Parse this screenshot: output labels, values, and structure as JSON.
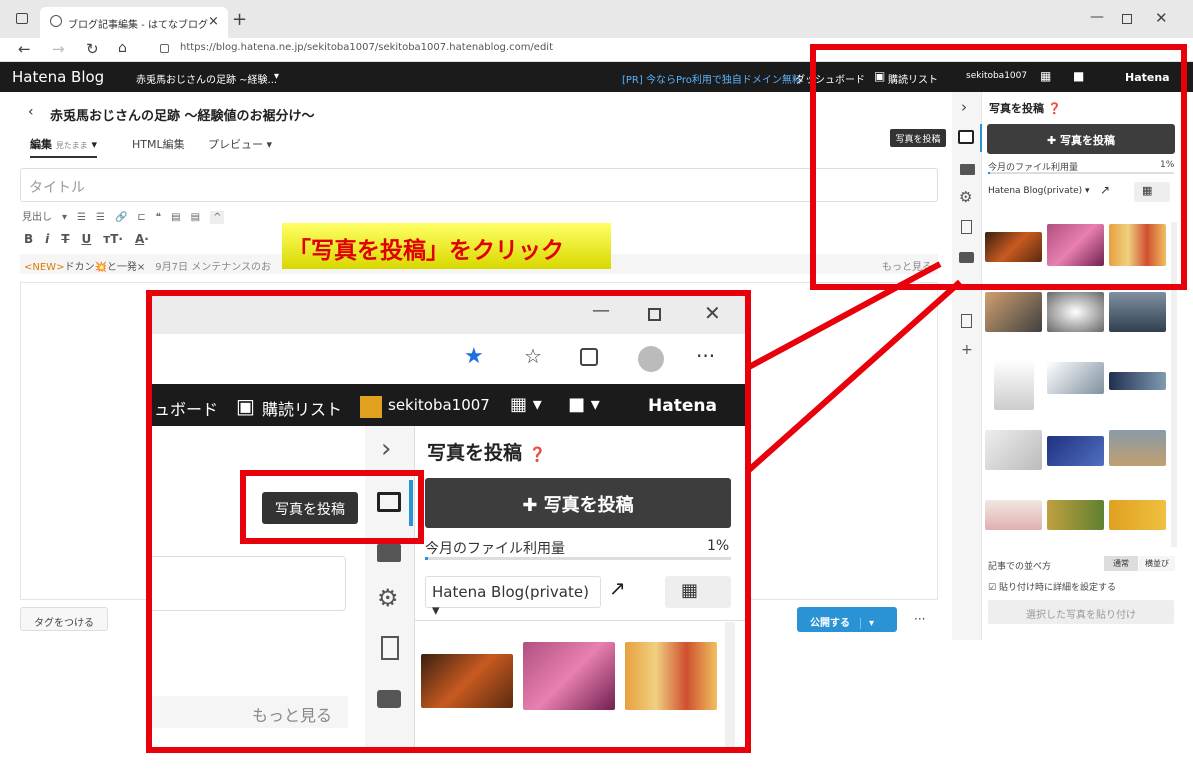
{
  "browser": {
    "tab_title": "ブログ記事編集 - はてなブログ",
    "url": "https://blog.hatena.ne.jp/sekitoba1007/sekitoba1007.hatenablog.com/edit"
  },
  "hatena_bar": {
    "logo": "Hatena Blog",
    "blog_name": "赤兎馬おじさんの足跡 ~経験...",
    "promo": "[PR] 今ならPro利用で独自ドメイン無料",
    "dashboard": "ダッシュボード",
    "dashboard_clipped": "ュボード",
    "reading_list": "購読リスト",
    "user": "sekitoba1007",
    "hatena": "Hatena"
  },
  "editor": {
    "blog_title": "赤兎馬おじさんの足跡 ～経験値のお裾分け～",
    "tabs": {
      "edit": "編集",
      "edit_sub": "見たまま",
      "html": "HTML編集",
      "preview": "プレビュー"
    },
    "title_placeholder": "タイトル",
    "toolbar_heading": "見出し",
    "notice_new": "<NEW>",
    "notice_text": "ドカン💥と一発×",
    "notice_text2": "9月7日 メンテナンスのお",
    "more": "もっと見る",
    "tag_button": "タグをつける",
    "publish_button": "公開する",
    "more_dots": "···"
  },
  "panel": {
    "title": "写真を投稿",
    "tooltip": "写真を投稿",
    "post_button": "写真を投稿",
    "usage_label": "今月のファイル利用量",
    "usage_value": "1%",
    "usage_fraction": 0.01,
    "album": "Hatena Blog(private)",
    "sort_label": "記事での並べ方",
    "sort_normal": "通常",
    "sort_horizontal": "横並び",
    "detail_checkbox": "貼り付け時に詳細を設定する",
    "paste_button": "選択した写真を貼り付け"
  },
  "callout": {
    "text": "「写真を投稿」をクリック"
  },
  "colors": {
    "red_highlight": "#e8000b",
    "hatena_bar": "#1b1b1b",
    "publish_blue": "#2a93d6",
    "callout_yellow": "#ffff66",
    "callout_text": "#e00000"
  },
  "icons": [
    "back-icon",
    "forward-icon",
    "refresh-icon",
    "home-icon",
    "lock-icon",
    "star-icon",
    "favorites-icon",
    "collections-icon",
    "profile-icon",
    "more-icon",
    "photo-icon",
    "folder-icon",
    "gear-icon",
    "document-icon",
    "youtube-icon",
    "clipboard-icon",
    "plus-icon",
    "chevron-right-icon",
    "help-icon",
    "external-link-icon",
    "grid-icon",
    "minimize-icon",
    "maximize-icon",
    "close-icon"
  ]
}
